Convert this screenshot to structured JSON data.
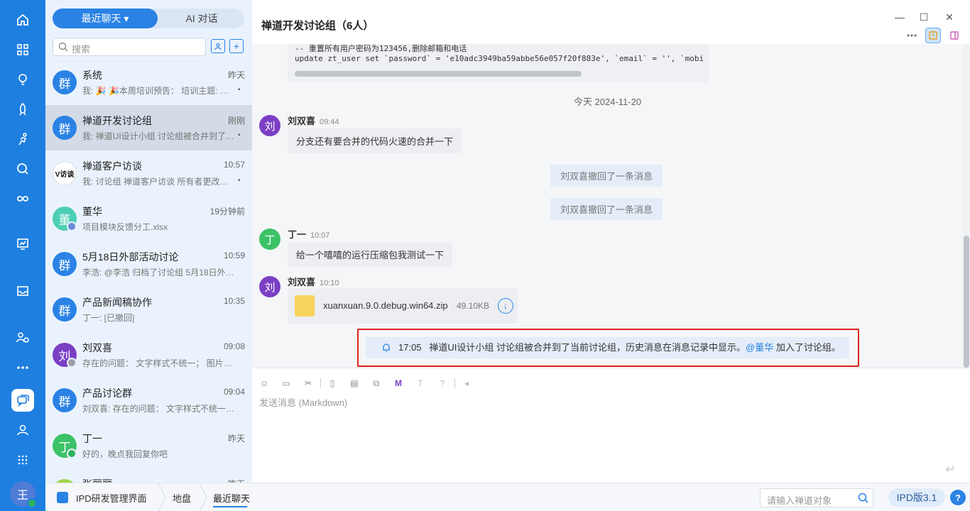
{
  "rail": {
    "items": [
      "home-icon",
      "apps-icon",
      "bulb-icon",
      "rocket-icon",
      "run-icon",
      "search-icon",
      "infinity-icon",
      "board-icon",
      "inbox-icon",
      "org-icon",
      "more-icon",
      "chat-icon",
      "contacts-icon",
      "grid-icon"
    ],
    "me_initial": "王"
  },
  "list": {
    "tab_recent": "最近聊天 ▾",
    "tab_ai": "AI 对话",
    "search_placeholder": "搜索",
    "conversations": [
      {
        "initial": "群",
        "name": "系统",
        "time": "昨天",
        "preview": "我: 🎉 🎉本周培训预告： 培训主题: 禅道...",
        "pinned": true,
        "color": "#2a82e4"
      },
      {
        "initial": "群",
        "name": "禅道开发讨论组",
        "time": "刚刚",
        "preview": "我: 禅道UI设计小组 讨论组被合并到了当前...",
        "pinned": true,
        "color": "#2a82e4"
      },
      {
        "initial": "V访谈",
        "name": "禅道客户访谈",
        "time": "10:57",
        "preview": "我: 讨论组 禅道客户访谈 所有者更改为 ...",
        "pinned": true,
        "color": "#ffffff"
      },
      {
        "initial": "董",
        "name": "董华",
        "time": "19分钟前",
        "preview": "项目模块反馈分工.xlsx",
        "pinned": false,
        "color": "#4ccfb4"
      },
      {
        "initial": "群",
        "name": "5月18日外部活动讨论",
        "time": "10:59",
        "preview": "李浩: @李浩 归档了讨论组 5月18日外部活...",
        "pinned": false,
        "color": "#2a82e4"
      },
      {
        "initial": "群",
        "name": "产品新闻稿协作",
        "time": "10:35",
        "preview": "丁一: [已撤回]",
        "pinned": false,
        "color": "#2a82e4"
      },
      {
        "initial": "刘",
        "name": "刘双喜",
        "time": "09:08",
        "preview": "存在的问题： 文字样式不统一； 图片大...",
        "pinned": false,
        "color": "#7b3fc4"
      },
      {
        "initial": "群",
        "name": "产品讨论群",
        "time": "09:04",
        "preview": "刘双喜: 存在的问题： 文字样式不统一；...",
        "pinned": false,
        "color": "#2a82e4"
      },
      {
        "initial": "丁",
        "name": "丁一",
        "time": "昨天",
        "preview": "好的，晚点我回复你吧",
        "pinned": false,
        "color": "#3cc267"
      },
      {
        "initial": "张",
        "name": "张丽丽",
        "time": "昨天",
        "preview": "",
        "pinned": false,
        "color": "#9ed84a"
      }
    ]
  },
  "chat": {
    "title": "禅道开发讨论组（6人）",
    "code_line1": "-- 重置所有用户密码为123456,删除邮箱和电话",
    "code_line2": "update zt_user set `password` = 'e10adc3949ba59abbe56e057f20f883e', `email` = '', `mobi",
    "date_divider": "今天 2024-11-20",
    "messages": [
      {
        "initial": "刘",
        "sender": "刘双喜",
        "time": "09:44",
        "text": "分支还有要合并的代码火速的合并一下",
        "color": "#7b3fc4"
      },
      {
        "initial": "丁",
        "sender": "丁一",
        "time": "10:07",
        "text": "给一个嘻嘻的运行压缩包我测试一下",
        "color": "#3cc267"
      },
      {
        "initial": "刘",
        "sender": "刘双喜",
        "time": "10:10",
        "text": "",
        "color": "#7b3fc4"
      }
    ],
    "revoke1": "刘双喜撤回了一条消息",
    "revoke2": "刘双喜撤回了一条消息",
    "file": {
      "name": "xuanxuan.9.0.debug.win64.zip",
      "size": "49.10KB"
    },
    "notice": {
      "time": "17:05",
      "text": "禅道UI设计小组 讨论组被合并到了当前讨论组，历史消息在消息记录中显示。",
      "mention": "@董华",
      "suffix": "加入了讨论组。"
    },
    "composer_placeholder": "发送消息 (Markdown)"
  },
  "statusbar": {
    "app": "IPD研发管理界面",
    "crumb1": "地盘",
    "crumb2": "最近聊天",
    "search_placeholder": "请输入禅道对象",
    "version": "IPD版3.1"
  }
}
